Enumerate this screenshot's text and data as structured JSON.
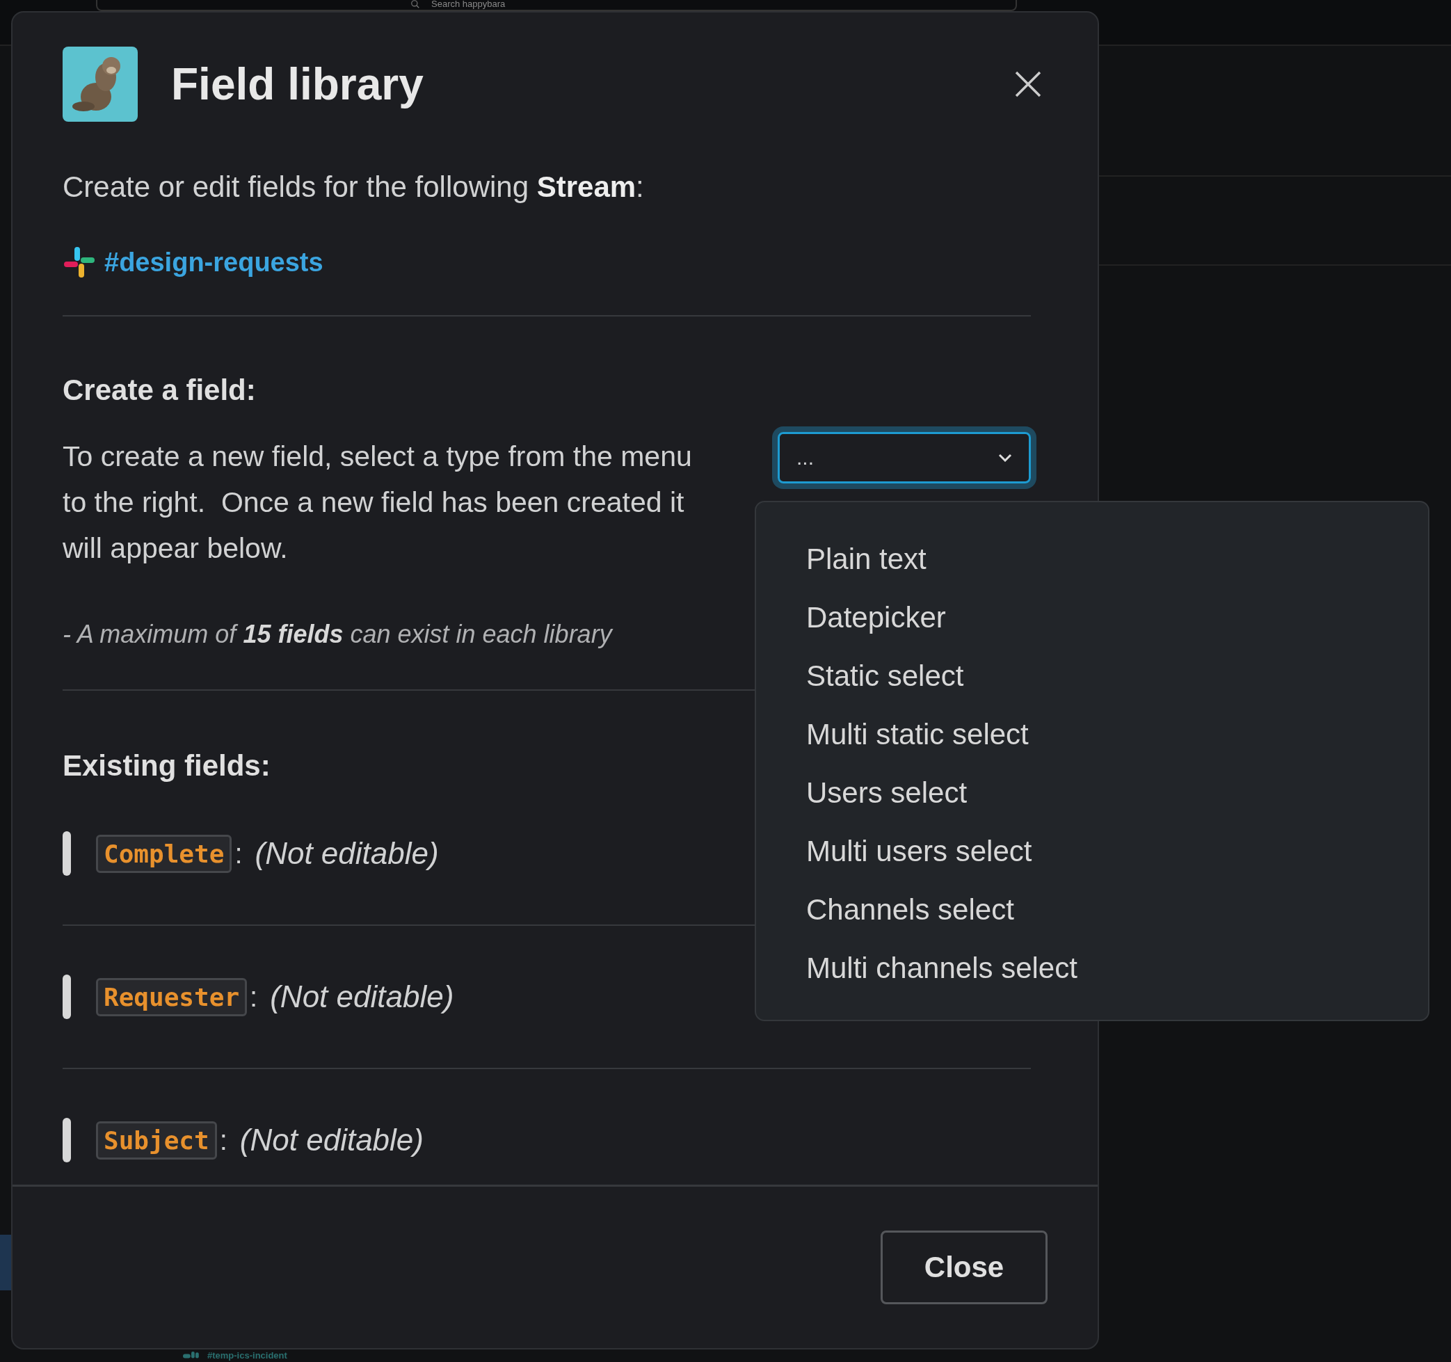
{
  "background": {
    "search": {
      "placeholder": "Search happybara"
    },
    "channel": "#temp-ics-incident"
  },
  "modal": {
    "title": "Field library",
    "intro": "Create or edit fields for the following **Stream**:",
    "channel": "#design-requests",
    "create_heading": "Create a field:",
    "create_text": "To create a new field, select a type from the menu to the right.  Once a new field has been created it will appear below.",
    "note": "- A maximum of **15 fields** can exist in each library",
    "type_select": {
      "value": "...",
      "expanded": true
    },
    "existing_heading": "Existing fields:",
    "fields": [
      {
        "name": "Complete",
        "separator": ":",
        "status": "(Not editable)"
      },
      {
        "name": "Requester",
        "separator": ":",
        "status": "(Not editable)"
      },
      {
        "name": "Subject",
        "separator": ":",
        "status": "(Not editable)"
      }
    ],
    "close_button": "Close"
  },
  "dropdown": {
    "options": [
      {
        "label": "Plain text"
      },
      {
        "label": "Datepicker"
      },
      {
        "label": "Static select"
      },
      {
        "label": "Multi static select"
      },
      {
        "label": "Users select"
      },
      {
        "label": "Multi users select"
      },
      {
        "label": "Channels select"
      },
      {
        "label": "Multi channels select"
      }
    ]
  }
}
